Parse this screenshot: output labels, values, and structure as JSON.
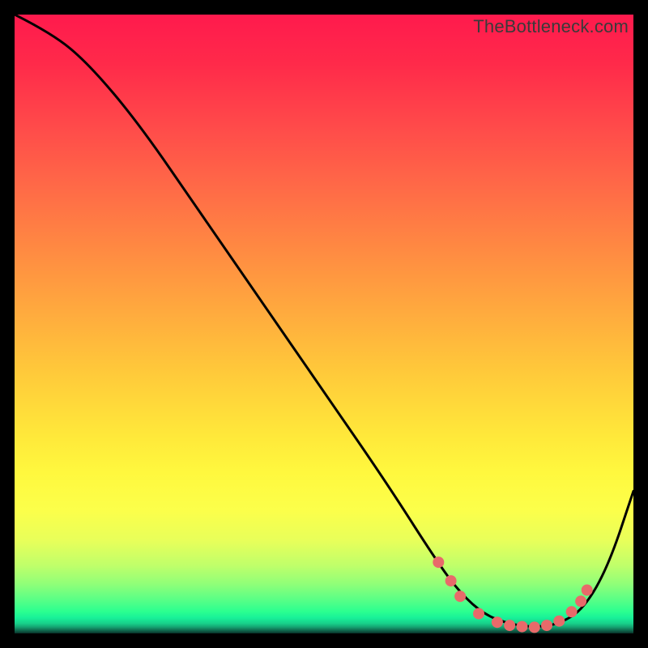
{
  "watermark": "TheBottleneck.com",
  "chart_data": {
    "type": "line",
    "title": "",
    "xlabel": "",
    "ylabel": "",
    "xlim": [
      0,
      100
    ],
    "ylim": [
      0,
      100
    ],
    "grid": false,
    "series": [
      {
        "name": "curve",
        "x": [
          0,
          6,
          12,
          20,
          30,
          40,
          50,
          60,
          68,
          72,
          76,
          80,
          84,
          88,
          92,
          96,
          100
        ],
        "y": [
          100,
          97,
          92,
          82.5,
          68,
          53.5,
          39,
          24.5,
          12,
          6.5,
          3,
          1.5,
          1,
          1.5,
          4,
          11,
          23
        ],
        "color": "#000000"
      }
    ],
    "markers": {
      "name": "trough-dots",
      "color": "#e86a6a",
      "points": [
        {
          "x": 68.5,
          "y": 11.5
        },
        {
          "x": 70.5,
          "y": 8.5
        },
        {
          "x": 72,
          "y": 6
        },
        {
          "x": 75,
          "y": 3.2
        },
        {
          "x": 78,
          "y": 1.8
        },
        {
          "x": 80,
          "y": 1.3
        },
        {
          "x": 82,
          "y": 1.1
        },
        {
          "x": 84,
          "y": 1.0
        },
        {
          "x": 86,
          "y": 1.3
        },
        {
          "x": 88,
          "y": 2.0
        },
        {
          "x": 90,
          "y": 3.5
        },
        {
          "x": 91.5,
          "y": 5.2
        },
        {
          "x": 92.5,
          "y": 7.0
        }
      ]
    },
    "background_gradient": {
      "orientation": "vertical",
      "stops": [
        {
          "pos": 0.0,
          "color": "#ff1a4d"
        },
        {
          "pos": 0.5,
          "color": "#ffca3a"
        },
        {
          "pos": 0.8,
          "color": "#fcff4a"
        },
        {
          "pos": 0.95,
          "color": "#2aff90"
        },
        {
          "pos": 1.0,
          "color": "#083028"
        }
      ]
    }
  }
}
